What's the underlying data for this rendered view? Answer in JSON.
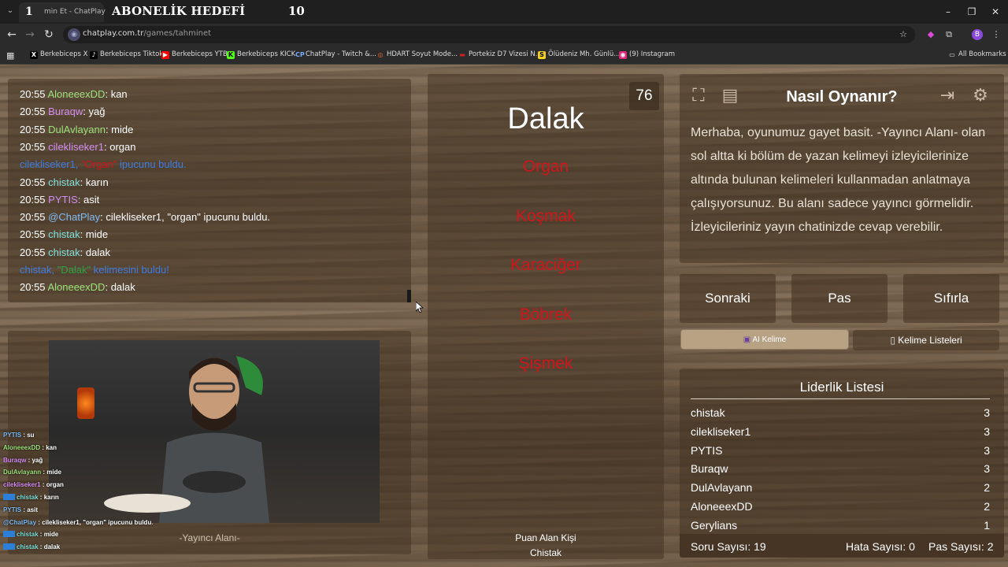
{
  "browser": {
    "tab_number": "1",
    "tab_title": "min Et - ChatPlay",
    "overlay_goal_text": "ABONELİK HEDEFİ",
    "overlay_goal_count": "10",
    "url_host": "chatplay.com.tr",
    "url_path": "/games/tahminet",
    "bookmarks": [
      {
        "label": "Berkebiceps X",
        "icon": "x-icon",
        "icon_glyph": "X",
        "icon_bg": "#000000",
        "icon_fg": "#ffffff"
      },
      {
        "label": "Berkebiceps Tiktok",
        "icon": "tiktok-icon",
        "icon_glyph": "♪",
        "icon_bg": "#000000",
        "icon_fg": "#ffffff"
      },
      {
        "label": "Berkebiceps YTB",
        "icon": "youtube-icon",
        "icon_glyph": "▶",
        "icon_bg": "#ff0000",
        "icon_fg": "#ffffff"
      },
      {
        "label": "Berkebiceps KICK",
        "icon": "kick-icon",
        "icon_glyph": "K",
        "icon_bg": "#53fc18",
        "icon_fg": "#000000"
      },
      {
        "label": "ChatPlay - Twitch &...",
        "icon": "chatplay-icon",
        "icon_glyph": "CP",
        "icon_bg": "#2b2b2b",
        "icon_fg": "#7aa8ff"
      },
      {
        "label": "HDART Soyut Mode...",
        "icon": "hdart-icon",
        "icon_glyph": "◎",
        "icon_bg": "#2b2b2b",
        "icon_fg": "#e06a2c"
      },
      {
        "label": "Portekiz D7 Vizesi N...",
        "icon": "doc-icon",
        "icon_glyph": "▬",
        "icon_bg": "#2b2b2b",
        "icon_fg": "#cc2222"
      },
      {
        "label": "Ölüdeniz Mh. Günlü...",
        "icon": "s-icon",
        "icon_glyph": "S",
        "icon_bg": "#f4d11b",
        "icon_fg": "#000000"
      },
      {
        "label": "(9) Instagram",
        "icon": "instagram-icon",
        "icon_glyph": "◉",
        "icon_bg": "#d62976",
        "icon_fg": "#ffffff"
      }
    ],
    "all_bookmarks": "All Bookmarks",
    "profile_initial": "B"
  },
  "chat": {
    "lines": [
      {
        "time": "20:55",
        "user": "AloneeexDD",
        "color": "#9be07a",
        "sep": ": ",
        "msg": "kan"
      },
      {
        "time": "20:55",
        "user": "Buraqw",
        "color": "#d38cf0",
        "sep": ": ",
        "msg": "yağ"
      },
      {
        "time": "20:55",
        "user": "DulAvlayann",
        "color": "#9be07a",
        "sep": ": ",
        "msg": "mide"
      },
      {
        "time": "20:55",
        "user": "cilekliseker1",
        "color": "#d38cf0",
        "sep": ": ",
        "msg": "organ"
      },
      {
        "time": "",
        "user": "cilekliseker1, ",
        "color": "#3d7be0",
        "sep": "",
        "msg": "\"Organ\" ipucunu buldu.",
        "msg_color": "#3d7be0",
        "highlight": "\"Organ\"",
        "highlight_color": "#d0151b",
        "rest": " ipucunu buldu."
      },
      {
        "time": "20:55",
        "user": "chistak",
        "color": "#7fe0d8",
        "sep": ": ",
        "msg": "karın"
      },
      {
        "time": "20:55",
        "user": "PYTIS",
        "color": "#d38cf0",
        "sep": ": ",
        "msg": "asit"
      },
      {
        "time": "20:55",
        "user": "@ChatPlay",
        "color": "#7fb8f0",
        "sep": ": ",
        "msg": "cilekliseker1, \"organ\" ipucunu buldu."
      },
      {
        "time": "20:55",
        "user": "chistak",
        "color": "#7fe0d8",
        "sep": ": ",
        "msg": "mide"
      },
      {
        "time": "20:55",
        "user": "chistak",
        "color": "#7fe0d8",
        "sep": ": ",
        "msg": "dalak"
      },
      {
        "time": "",
        "user": "chistak, ",
        "color": "#3d7be0",
        "sep": "",
        "msg": "",
        "highlight": "\"Dalak\"",
        "highlight_color": "#2ea043",
        "rest": " kelimesini buldu!"
      },
      {
        "time": "20:55",
        "user": "AloneeexDD",
        "color": "#9be07a",
        "sep": ": ",
        "msg": "dalak"
      }
    ]
  },
  "stream": {
    "label": "-Yayıncı Alanı-",
    "mini_chat": [
      {
        "user": "PYTIS",
        "color": "#7fb8f0",
        "msg": " : su",
        "badge": false
      },
      {
        "user": "AloneeexDD",
        "color": "#9be07a",
        "msg": " : kan",
        "badge": false
      },
      {
        "user": "Buraqw",
        "color": "#d38cf0",
        "msg": " : yağ",
        "badge": false
      },
      {
        "user": "DulAvlayann",
        "color": "#9be07a",
        "msg": " : mide",
        "badge": false
      },
      {
        "user": "cilekliseker1",
        "color": "#d38cf0",
        "msg": " : organ",
        "badge": false
      },
      {
        "user": "chistak",
        "color": "#7fe0d8",
        "msg": " : karın",
        "badge": true
      },
      {
        "user": "PYTIS",
        "color": "#7fb8f0",
        "msg": " : asit",
        "badge": false
      },
      {
        "user": "@ChatPlay",
        "color": "#7fb8f0",
        "msg": " : cilekliseker1, \"organ\" ipucunu buldu.",
        "badge": false
      },
      {
        "user": "chistak",
        "color": "#7fe0d8",
        "msg": " : mide",
        "badge": true
      },
      {
        "user": "chistak",
        "color": "#7fe0d8",
        "msg": " : dalak",
        "badge": true
      }
    ]
  },
  "game": {
    "counter": "76",
    "word": "Dalak",
    "taboo_words": [
      "Organ",
      "Koşmak",
      "Karaciğer",
      "Böbrek",
      "Şişmek"
    ],
    "taboo_color": "#d0151b",
    "scorer_label": "Puan Alan Kişi",
    "scorer_name": "Chistak"
  },
  "help": {
    "title": "Nasıl Oynanır?",
    "text": "Merhaba, oyunumuz gayet basit. -Yayıncı Alanı- olan sol altta ki bölüm de yazan kelimeyi izleyicilerinize altında bulunan kelimeleri kullanmadan anlatmaya çalışıyorsunuz. Bu alanı sadece yayıncı görmelidir. İzleyicileriniz yayın chatinizde cevap verebilir."
  },
  "controls": {
    "next": "Sonraki",
    "pass": "Pas",
    "reset": "Sıfırla",
    "ai_word": "AI Kelime",
    "word_lists": "Kelime Listeleri"
  },
  "leaderboard": {
    "title": "Liderlik Listesi",
    "rows": [
      {
        "name": "chistak",
        "score": "3"
      },
      {
        "name": "cilekliseker1",
        "score": "3"
      },
      {
        "name": "PYTIS",
        "score": "3"
      },
      {
        "name": "Buraqw",
        "score": "3"
      },
      {
        "name": "DulAvlayann",
        "score": "2"
      },
      {
        "name": "AloneeexDD",
        "score": "2"
      },
      {
        "name": "Gerylians",
        "score": "1"
      }
    ],
    "question_count": "Soru Sayısı: 19",
    "error_count": "Hata Sayısı: 0",
    "pass_count": "Pas Sayısı: 2"
  }
}
